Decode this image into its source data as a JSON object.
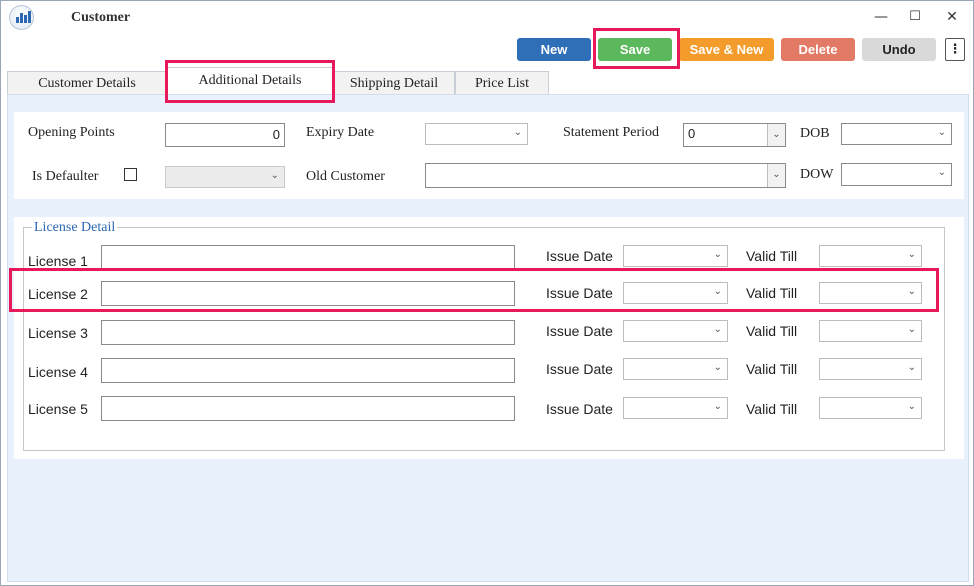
{
  "window": {
    "title": "Customer",
    "controls": {
      "minimize": "—",
      "maximize": "☐",
      "close": "✕"
    }
  },
  "toolbar": {
    "new": "New",
    "save": "Save",
    "save_new": "Save & New",
    "delete": "Delete",
    "undo": "Undo",
    "more": "⋮"
  },
  "tabs": [
    {
      "label": "Customer Details"
    },
    {
      "label": "Additional Details"
    },
    {
      "label": "Shipping Detail"
    },
    {
      "label": "Price List"
    }
  ],
  "fields": {
    "opening_points": {
      "label": "Opening Points",
      "value": "0"
    },
    "expiry_date": {
      "label": "Expiry Date",
      "value": ""
    },
    "statement_period": {
      "label": "Statement Period",
      "value": "0"
    },
    "dob": {
      "label": "DOB",
      "value": ""
    },
    "is_defaulter": {
      "label": "Is Defaulter"
    },
    "old_customer": {
      "label": "Old Customer",
      "value": ""
    },
    "dow": {
      "label": "DOW",
      "value": ""
    }
  },
  "license_detail": {
    "legend": "License Detail",
    "issue_label": "Issue Date",
    "valid_label": "Valid Till",
    "rows": [
      {
        "label": "License 1",
        "value": ""
      },
      {
        "label": "License 2",
        "value": ""
      },
      {
        "label": "License 3",
        "value": ""
      },
      {
        "label": "License 4",
        "value": ""
      },
      {
        "label": "License 5",
        "value": ""
      }
    ]
  },
  "colors": {
    "new": "#2f6fb7",
    "save": "#5cb85c",
    "save_new": "#f39c2b",
    "delete": "#e27a65",
    "undo": "#d9d9d9",
    "highlight": "#e8195a",
    "panel_bg": "#e8f1fc",
    "legend": "#2b67b5"
  },
  "icons": {
    "app": "chart-app-icon",
    "chevron": "chevron-down-icon",
    "more": "kebab-menu-icon"
  }
}
